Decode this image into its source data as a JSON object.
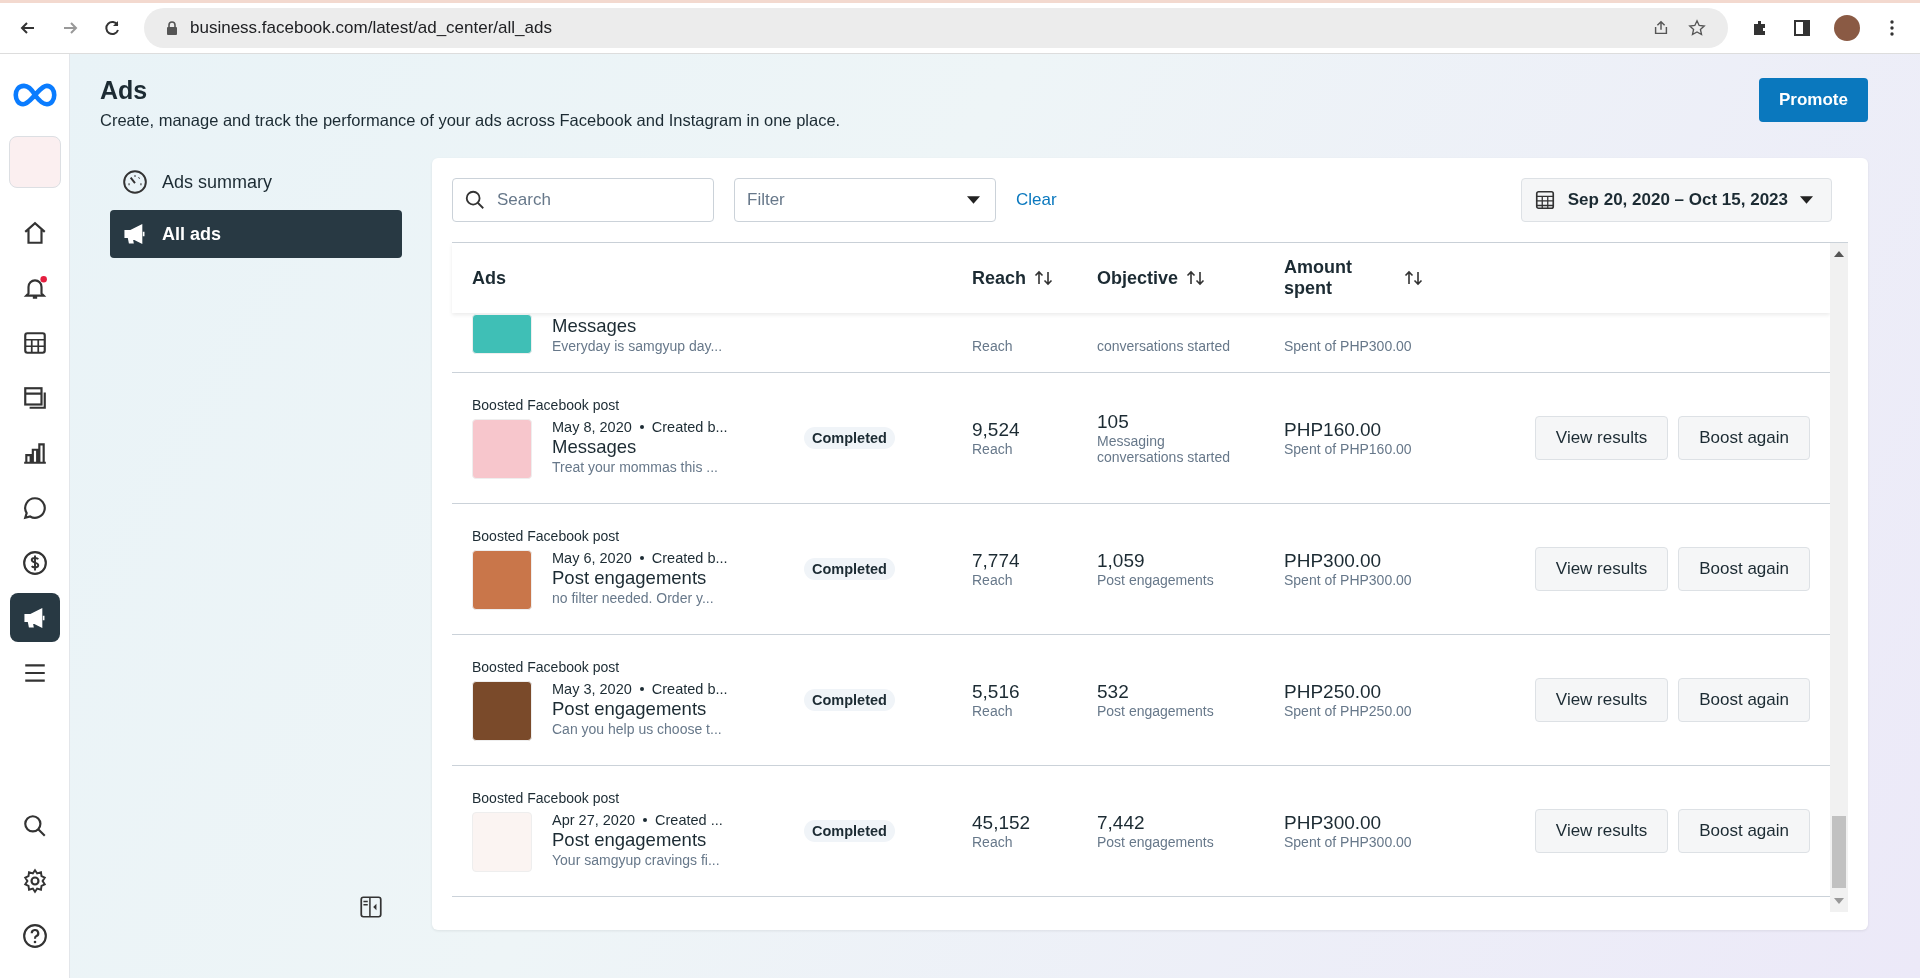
{
  "browser": {
    "url": "business.facebook.com/latest/ad_center/all_ads"
  },
  "rail": {
    "top": [
      {
        "kind": "home",
        "selected": false
      },
      {
        "kind": "bell",
        "selected": false,
        "unread": true
      },
      {
        "kind": "table",
        "selected": false
      },
      {
        "kind": "pages",
        "selected": false
      },
      {
        "kind": "chart",
        "selected": false
      },
      {
        "kind": "chat",
        "selected": false
      },
      {
        "kind": "dollar",
        "selected": false
      },
      {
        "kind": "megaphone",
        "selected": true
      },
      {
        "kind": "menu",
        "selected": false
      }
    ],
    "bottom": [
      {
        "kind": "search"
      },
      {
        "kind": "gear"
      },
      {
        "kind": "help"
      }
    ]
  },
  "header": {
    "title": "Ads",
    "subtitle": "Create, manage and track the performance of your ads across Facebook and Instagram in one place.",
    "action": "Promote"
  },
  "nav": [
    {
      "kind": "gauge",
      "label": "Ads summary",
      "selected": false
    },
    {
      "kind": "megaphone",
      "label": "All ads",
      "selected": true
    }
  ],
  "toolbar": {
    "search_placeholder": "Search",
    "filter_placeholder": "Filter",
    "clear": "Clear",
    "date_range": "Sep 20, 2020 – Oct 15, 2023"
  },
  "table": {
    "columns": [
      {
        "label": "Ads",
        "sortable": false
      },
      {
        "label": "Reach",
        "sortable": true
      },
      {
        "label": "Objective",
        "sortable": true
      },
      {
        "label": "Amount spent",
        "sortable": true
      }
    ],
    "rows": [
      {
        "kind": "clipped",
        "title": "Messages",
        "description": "Everyday is samgyup day...",
        "reach_label": "Reach",
        "objective_label": "conversations started",
        "spent": "Spent of PHP300.00"
      },
      {
        "kind": "full",
        "type": "Boosted Facebook post",
        "date": "May 8, 2020",
        "creator": "Created b...",
        "title": "Messages",
        "description": "Treat your mommas this ...",
        "status": "Completed",
        "reach": "9,524",
        "reach_label": "Reach",
        "objective": "105",
        "objective_label": "Messaging conversations started",
        "amount": "PHP160.00",
        "spent": "Spent of PHP160.00",
        "actions": [
          "View results",
          "Boost again"
        ]
      },
      {
        "kind": "full",
        "type": "Boosted Facebook post",
        "date": "May 6, 2020",
        "creator": "Created b...",
        "title": "Post engagements",
        "description": "no filter needed. Order y...",
        "status": "Completed",
        "reach": "7,774",
        "reach_label": "Reach",
        "objective": "1,059",
        "objective_label": "Post engagements",
        "amount": "PHP300.00",
        "spent": "Spent of PHP300.00",
        "actions": [
          "View results",
          "Boost again"
        ]
      },
      {
        "kind": "full",
        "type": "Boosted Facebook post",
        "date": "May 3, 2020",
        "creator": "Created b...",
        "title": "Post engagements",
        "description": "Can you help us choose t...",
        "status": "Completed",
        "reach": "5,516",
        "reach_label": "Reach",
        "objective": "532",
        "objective_label": "Post engagements",
        "amount": "PHP250.00",
        "spent": "Spent of PHP250.00",
        "actions": [
          "View results",
          "Boost again"
        ]
      },
      {
        "kind": "full",
        "type": "Boosted Facebook post",
        "date": "Apr 27, 2020",
        "creator": "Created ...",
        "title": "Post engagements",
        "description": "Your samgyup cravings fi...",
        "status": "Completed",
        "reach": "45,152",
        "reach_label": "Reach",
        "objective": "7,442",
        "objective_label": "Post engagements",
        "amount": "PHP300.00",
        "spent": "Spent of PHP300.00",
        "actions": [
          "View results",
          "Boost again"
        ]
      }
    ]
  }
}
